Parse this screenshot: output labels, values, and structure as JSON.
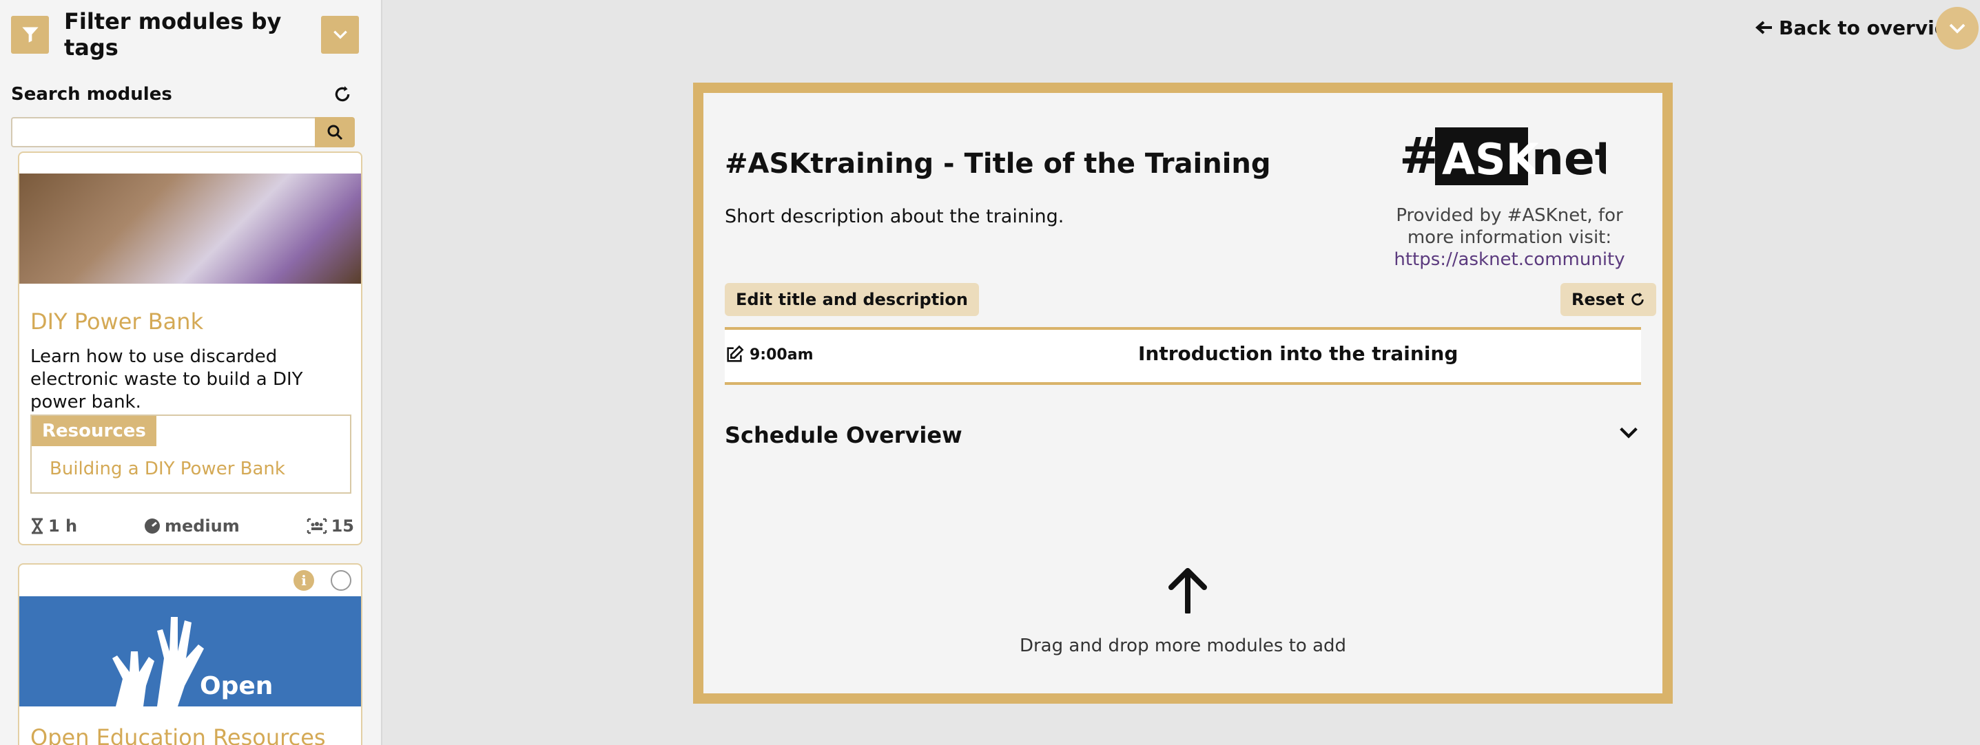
{
  "sidebar": {
    "filter_title": "Filter modules by tags",
    "search_label": "Search modules",
    "search_value": "",
    "search_placeholder": ""
  },
  "cards": [
    {
      "title": "DIY Power Bank",
      "description": "Learn how to use discarded electronic waste to build a DIY power bank.",
      "resources_header": "Resources",
      "resource_link": "Building a DIY Power Bank",
      "duration": "1 h",
      "difficulty": "medium",
      "participants": "15"
    },
    {
      "title": "Open Education Resources",
      "image_text": "Open"
    }
  ],
  "header": {
    "back_label": "Back to overview"
  },
  "training": {
    "title": "#ASKtraining - Title of the Training",
    "description": "Short description about the training.",
    "provided_text": "Provided by #ASKnet, for more information visit:",
    "provided_link": "https://asknet.community",
    "edit_button": "Edit title and description",
    "reset_button": "Reset",
    "schedule": [
      {
        "time": "9:00am",
        "label": "Introduction into the training"
      }
    ],
    "overview_title": "Schedule Overview",
    "drag_text": "Drag and drop more modules to add"
  },
  "logo": {
    "hash": "#",
    "ask": "ASK",
    "net": "net"
  },
  "colors": {
    "accent": "#d9b878",
    "border": "#d9b36a",
    "link": "#5b3a7e",
    "card_title": "#d4a955"
  },
  "icons": [
    "filter-icon",
    "chevron-down-icon",
    "refresh-icon",
    "search-icon",
    "info-icon",
    "hourglass-icon",
    "gauge-icon",
    "group-icon",
    "arrow-left-icon",
    "edit-icon",
    "arrow-up-icon"
  ]
}
